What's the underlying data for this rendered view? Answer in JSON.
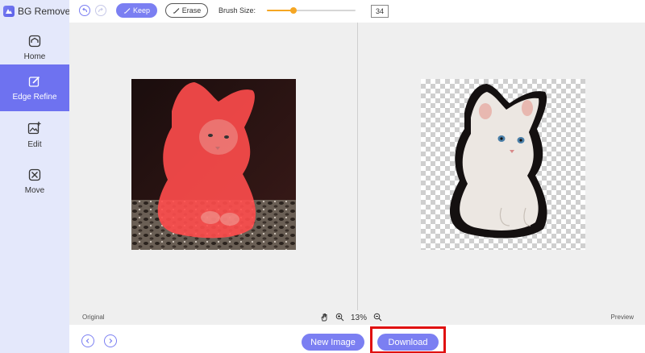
{
  "app": {
    "name": "BG Remover"
  },
  "sidebar": {
    "items": [
      {
        "label": "Home",
        "icon": "home-icon",
        "active": false
      },
      {
        "label": "Edge Refine",
        "icon": "edge-refine-icon",
        "active": true
      },
      {
        "label": "Edit",
        "icon": "edit-image-icon",
        "active": false
      },
      {
        "label": "Move",
        "icon": "move-icon",
        "active": false
      }
    ]
  },
  "toolbar": {
    "keep_label": "Keep",
    "erase_label": "Erase",
    "brush_size_label": "Brush Size:",
    "brush_size_value": "34"
  },
  "status": {
    "original_label": "Original",
    "preview_label": "Preview",
    "zoom": "13%"
  },
  "bottom": {
    "new_image_label": "New Image",
    "download_label": "Download"
  },
  "colors": {
    "accent": "#7b7ff2",
    "active_nav": "#6e72f0",
    "slider": "#f5a623",
    "highlight": "#e01010",
    "keep_mask": "#ff4d4d"
  }
}
